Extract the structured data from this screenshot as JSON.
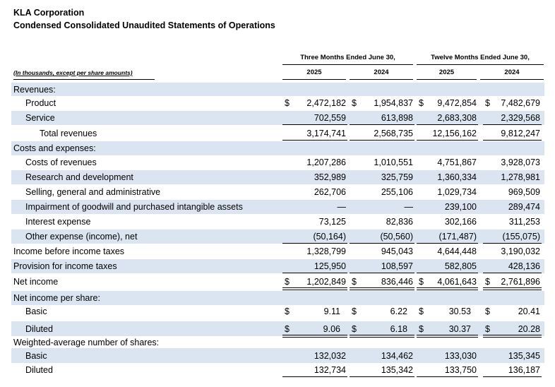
{
  "header": {
    "company": "KLA Corporation",
    "statement_title": "Condensed Consolidated Unaudited Statements of Operations",
    "units_note": "(In thousands, except per share amounts)",
    "period_groups": [
      "Three Months Ended June 30,",
      "Twelve Months Ended June 30,"
    ],
    "columns": [
      "2025",
      "2024",
      "2025",
      "2024"
    ]
  },
  "rows": [
    {
      "label": "Revenues:",
      "indent": 0,
      "shaded": true,
      "dollar": false,
      "values": [
        "",
        "",
        "",
        ""
      ]
    },
    {
      "label": "Product",
      "indent": 1,
      "shaded": false,
      "dollar": true,
      "values": [
        "2,472,182",
        "1,954,837",
        "9,472,854",
        "7,482,679"
      ]
    },
    {
      "label": "Service",
      "indent": 1,
      "shaded": true,
      "dollar": false,
      "values": [
        "702,559",
        "613,898",
        "2,683,308",
        "2,329,568"
      ]
    },
    {
      "label": "Total revenues",
      "indent": 2,
      "shaded": false,
      "dollar": false,
      "values": [
        "3,174,741",
        "2,568,735",
        "12,156,162",
        "9,812,247"
      ]
    },
    {
      "label": "Costs and expenses:",
      "indent": 0,
      "shaded": true,
      "dollar": false,
      "values": [
        "",
        "",
        "",
        ""
      ]
    },
    {
      "label": "Costs of revenues",
      "indent": 1,
      "shaded": false,
      "dollar": false,
      "values": [
        "1,207,286",
        "1,010,551",
        "4,751,867",
        "3,928,073"
      ]
    },
    {
      "label": "Research and development",
      "indent": 1,
      "shaded": true,
      "dollar": false,
      "values": [
        "352,989",
        "325,759",
        "1,360,334",
        "1,278,981"
      ]
    },
    {
      "label": "Selling, general and administrative",
      "indent": 1,
      "shaded": false,
      "dollar": false,
      "values": [
        "262,706",
        "255,106",
        "1,029,734",
        "969,509"
      ]
    },
    {
      "label": "Impairment of goodwill and purchased intangible assets",
      "indent": 1,
      "shaded": true,
      "dollar": false,
      "values": [
        "—",
        "—",
        "239,100",
        "289,474"
      ]
    },
    {
      "label": "Interest expense",
      "indent": 1,
      "shaded": false,
      "dollar": false,
      "values": [
        "73,125",
        "82,836",
        "302,166",
        "311,253"
      ]
    },
    {
      "label": "Other expense (income), net",
      "indent": 1,
      "shaded": true,
      "dollar": false,
      "values": [
        "(50,164)",
        "(50,560)",
        "(171,487)",
        "(155,075)"
      ]
    },
    {
      "label": "Income before income taxes",
      "indent": 0,
      "shaded": false,
      "dollar": false,
      "values": [
        "1,328,799",
        "945,043",
        "4,644,448",
        "3,190,032"
      ]
    },
    {
      "label": "Provision for income taxes",
      "indent": 0,
      "shaded": true,
      "dollar": false,
      "values": [
        "125,950",
        "108,597",
        "582,805",
        "428,136"
      ]
    },
    {
      "label": "Net income",
      "indent": 0,
      "shaded": false,
      "dollar": true,
      "values": [
        "1,202,849",
        "836,446",
        "4,061,643",
        "2,761,896"
      ]
    },
    {
      "label": "Net income per share:",
      "indent": 0,
      "shaded": true,
      "dollar": false,
      "values": [
        "",
        "",
        "",
        ""
      ]
    },
    {
      "label": "Basic",
      "indent": 1,
      "shaded": false,
      "dollar": true,
      "values": [
        "9.11",
        "6.22",
        "30.53",
        "20.41"
      ]
    },
    {
      "label": "Diluted",
      "indent": 1,
      "shaded": true,
      "dollar": true,
      "values": [
        "9.06",
        "6.18",
        "30.37",
        "20.28"
      ]
    },
    {
      "label": "Weighted-average number of shares:",
      "indent": 0,
      "shaded": false,
      "dollar": false,
      "values": [
        "",
        "",
        "",
        ""
      ]
    },
    {
      "label": "Basic",
      "indent": 1,
      "shaded": true,
      "dollar": false,
      "values": [
        "132,032",
        "134,462",
        "133,030",
        "135,345"
      ]
    },
    {
      "label": "Diluted",
      "indent": 1,
      "shaded": false,
      "dollar": false,
      "values": [
        "132,734",
        "135,342",
        "133,750",
        "136,187"
      ]
    }
  ],
  "currency_symbol": "$",
  "colors": {
    "row_shade": "#dbe5f1",
    "text": "#000000",
    "rule": "#000000"
  }
}
